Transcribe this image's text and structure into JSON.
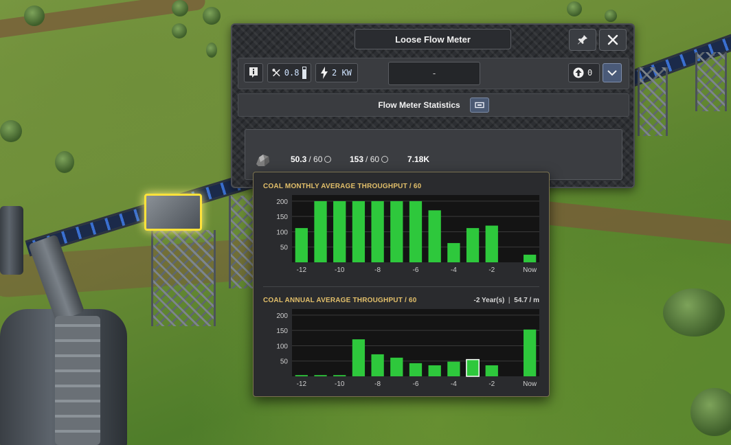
{
  "window": {
    "title": "Loose Flow Meter",
    "maintenance_value": "0.8",
    "power_value": "2 KW",
    "selector_value": "-",
    "priority_value": "0",
    "section_title": "Flow Meter Statistics"
  },
  "stats": {
    "monthly_value": "50.3",
    "monthly_suffix": "/ 60",
    "annual_value": "153",
    "annual_suffix": "/ 60",
    "total": "7.18K"
  },
  "colors": {
    "bar": "#2ec83c",
    "chart_bg": "#141414",
    "title_gold": "#e2bf6a",
    "grid": "#3a3a3a"
  },
  "chart_data": [
    {
      "type": "bar",
      "title": "COAL MONTHLY AVERAGE THROUGHPUT / 60",
      "categories": [
        "-12",
        "-11",
        "-10",
        "-9",
        "-8",
        "-7",
        "-6",
        "-5",
        "-4",
        "-3",
        "-2",
        "-1",
        "Now"
      ],
      "tick_labels": [
        "-12",
        "-10",
        "-8",
        "-6",
        "-4",
        "-2",
        "Now"
      ],
      "values": [
        112,
        200,
        200,
        200,
        200,
        200,
        200,
        170,
        63,
        112,
        120,
        0,
        25
      ],
      "yticks": [
        50,
        100,
        150,
        200
      ],
      "ylim": [
        0,
        220
      ],
      "highlight_index": null
    },
    {
      "type": "bar",
      "title": "COAL ANNUAL AVERAGE THROUGHPUT / 60",
      "hover_label": "-2 Year(s)",
      "hover_value": "54.7 / m",
      "categories": [
        "-12",
        "-11",
        "-10",
        "-9",
        "-8",
        "-7",
        "-6",
        "-5",
        "-4",
        "-3",
        "-2",
        "-1",
        "Now"
      ],
      "tick_labels": [
        "-12",
        "-10",
        "-8",
        "-6",
        "-4",
        "-2",
        "Now"
      ],
      "values": [
        4,
        4,
        4,
        121,
        72,
        61,
        43,
        36,
        48,
        54.7,
        36,
        0,
        153
      ],
      "yticks": [
        50,
        100,
        150,
        200
      ],
      "ylim": [
        0,
        220
      ],
      "highlight_index": 9
    }
  ]
}
